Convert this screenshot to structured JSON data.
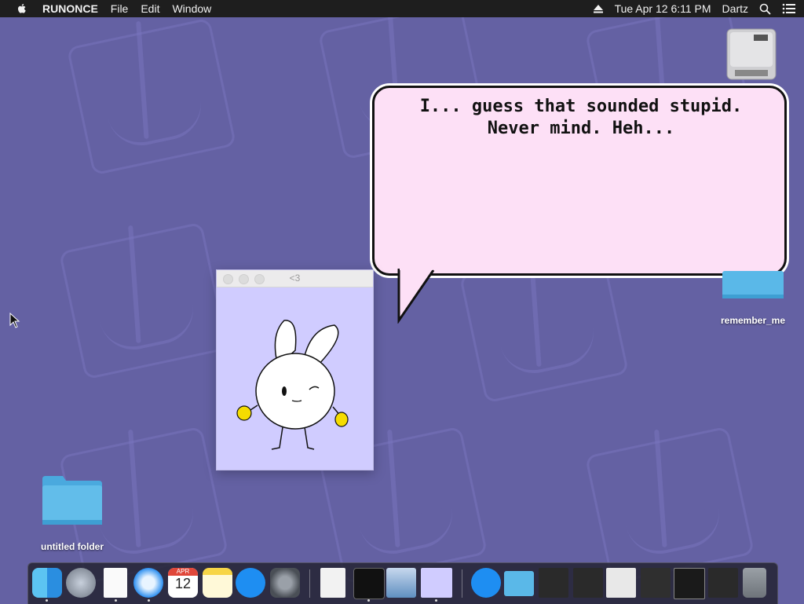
{
  "menubar": {
    "app_name": "RUNONCE",
    "menus": [
      "File",
      "Edit",
      "Window"
    ],
    "clock": "Tue Apr 12  6:11 PM",
    "user": "Dartz"
  },
  "bubble": {
    "text": "I... guess that sounded stupid. Never mind. Heh..."
  },
  "pet_window": {
    "title": "<3"
  },
  "desktop": {
    "folder_right_label": "remember_me",
    "folder_left_label": "untitled folder"
  },
  "dock": {
    "calendar_month": "APR",
    "calendar_day": "12"
  },
  "colors": {
    "wallpaper": "#6461a3",
    "bubble": "#fde0f6",
    "pet_bg": "#d0ccff",
    "folder": "#5ab8e8"
  }
}
